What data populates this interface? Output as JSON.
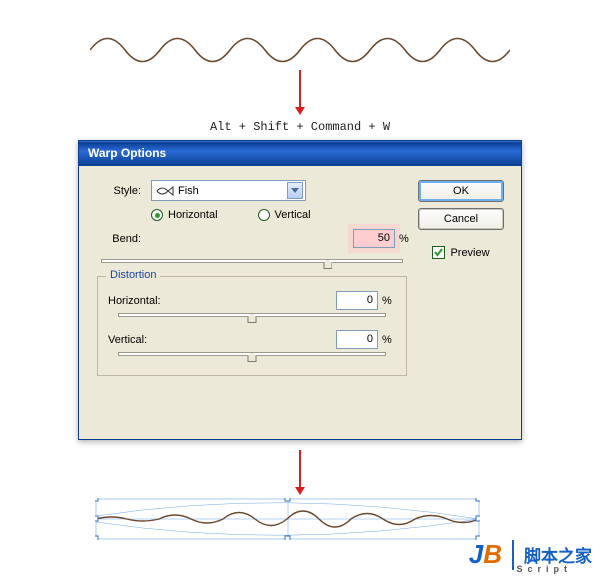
{
  "shortcut": "Alt + Shift + Command + W",
  "dialog": {
    "title": "Warp Options",
    "style_label": "Style:",
    "style_value": "Fish",
    "orientation": {
      "horizontal_label": "Horizontal",
      "vertical_label": "Vertical",
      "selected": "horizontal"
    },
    "bend": {
      "label": "Bend:",
      "value": "50",
      "unit": "%"
    },
    "distortion": {
      "legend": "Distortion",
      "horizontal_label": "Horizontal:",
      "horizontal_value": "0",
      "vertical_label": "Vertical:",
      "vertical_value": "0",
      "unit": "%"
    },
    "buttons": {
      "ok": "OK",
      "cancel": "Cancel"
    },
    "preview": {
      "label": "Preview",
      "checked": true
    }
  },
  "watermark": {
    "brand_j": "J",
    "brand_b": "B",
    "text": "脚本之家",
    "sub": "Script"
  }
}
